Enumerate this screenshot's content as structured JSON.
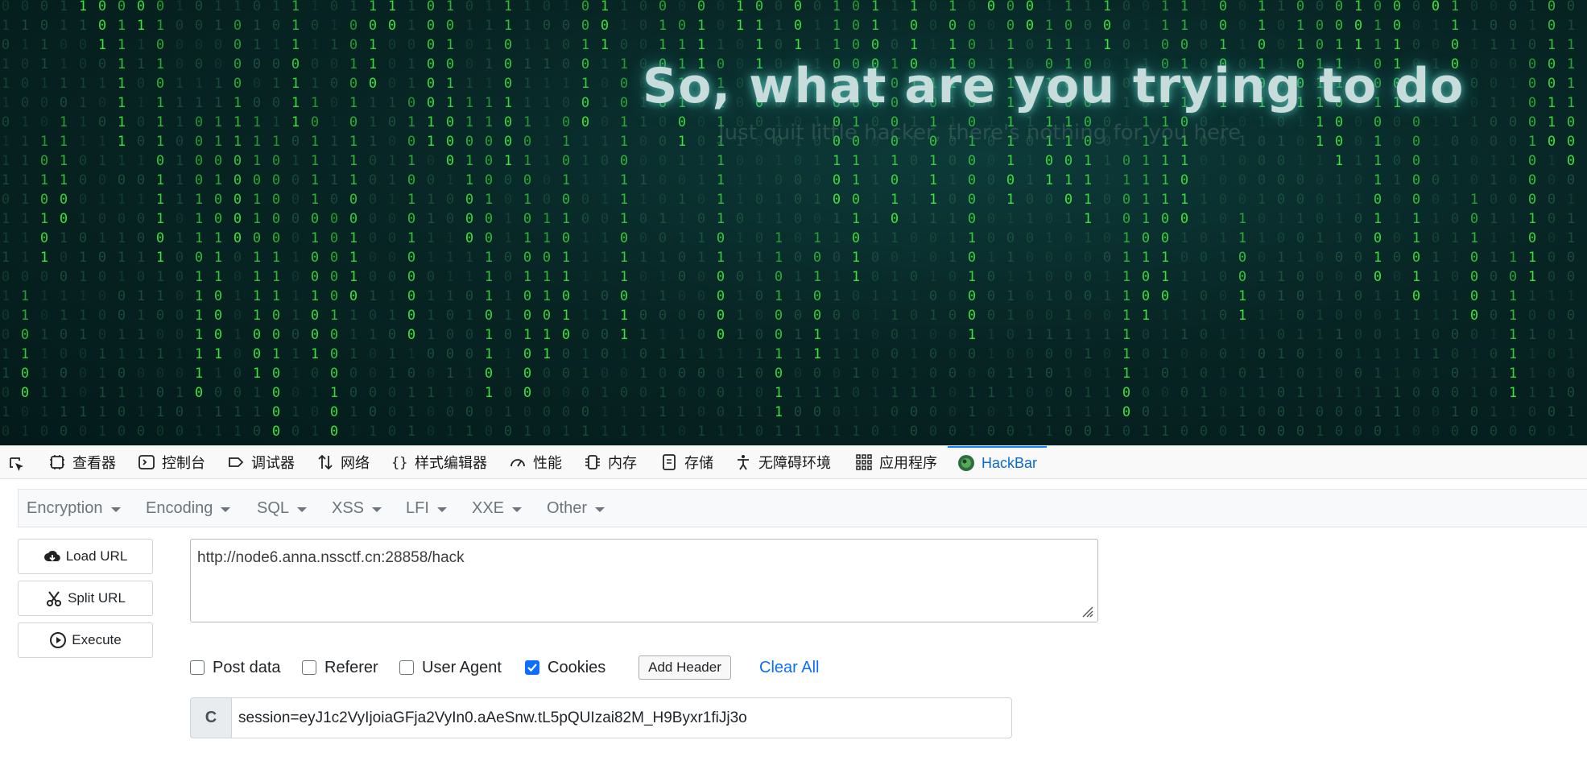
{
  "hero": {
    "title": "So, what are you trying to do",
    "subtitle": "Just quit little hacker, there's nothing for you here"
  },
  "devtools": {
    "tabs": [
      {
        "label": "查看器",
        "icon": "inspector-icon"
      },
      {
        "label": "控制台",
        "icon": "console-icon"
      },
      {
        "label": "调试器",
        "icon": "debugger-icon"
      },
      {
        "label": "网络",
        "icon": "network-icon"
      },
      {
        "label": "样式编辑器",
        "icon": "braces-icon"
      },
      {
        "label": "性能",
        "icon": "gauge-icon"
      },
      {
        "label": "内存",
        "icon": "memory-icon"
      },
      {
        "label": "存储",
        "icon": "storage-icon"
      },
      {
        "label": "无障碍环境",
        "icon": "accessibility-icon"
      },
      {
        "label": "应用程序",
        "icon": "grid-icon"
      },
      {
        "label": "HackBar",
        "icon": "hackbar-icon",
        "active": true
      }
    ]
  },
  "hackbar": {
    "menu": [
      "Encryption",
      "Encoding",
      "SQL",
      "XSS",
      "LFI",
      "XXE",
      "Other"
    ],
    "buttons": {
      "load_url": "Load URL",
      "split_url": "Split URL",
      "execute": "Execute"
    },
    "url": "http://node6.anna.nssctf.cn:28858/hack",
    "options": {
      "post_data": "Post data",
      "referer": "Referer",
      "user_agent": "User Agent",
      "cookies": "Cookies"
    },
    "checked": {
      "post_data": false,
      "referer": false,
      "user_agent": false,
      "cookies": true
    },
    "add_header": "Add Header",
    "clear_all": "Clear All",
    "cookie_prefix": "C",
    "cookie_value": "session=eyJ1c2VyIjoiaGFja2VyIn0.aAeSnw.tL5pQUIzai82M_H9Byxr1fiJj3o"
  },
  "colors": {
    "rain_bright": "#39e639",
    "rain_dim": "#2a6a4a",
    "active_tab": "#0a84ff",
    "link": "#0d6efd"
  }
}
